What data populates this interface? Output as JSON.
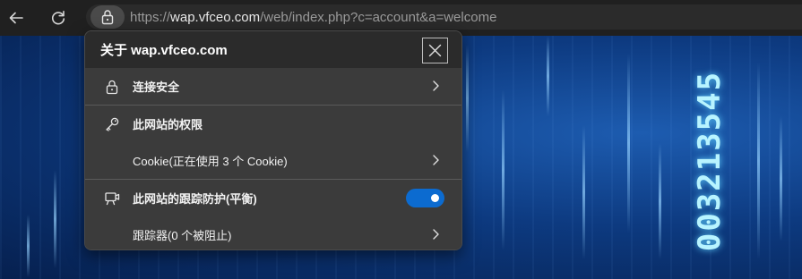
{
  "address_bar": {
    "url_prefix": "https://",
    "url_host": "wap.vfceo.com",
    "url_path": "/web/index.php?c=account&a=welcome"
  },
  "toolbar": {
    "back_icon": "back-arrow-icon",
    "refresh_icon": "refresh-icon",
    "lock_icon": "lock-icon"
  },
  "background": {
    "digits": "003213545"
  },
  "site_info_popup": {
    "title": "关于 wap.vfceo.com",
    "connection_label": "连接安全",
    "permissions_label": "此网站的权限",
    "cookies_label": "Cookie(正在使用 3 个 Cookie)",
    "tracking_label": "此网站的跟踪防护(平衡)",
    "tracking_enabled": true,
    "trackers_label": "跟踪器(0 个被阻止)"
  },
  "colors": {
    "accent": "#0c6bd0",
    "popup_bg": "#3b3b3b",
    "header_bg": "#2b2b2b"
  }
}
